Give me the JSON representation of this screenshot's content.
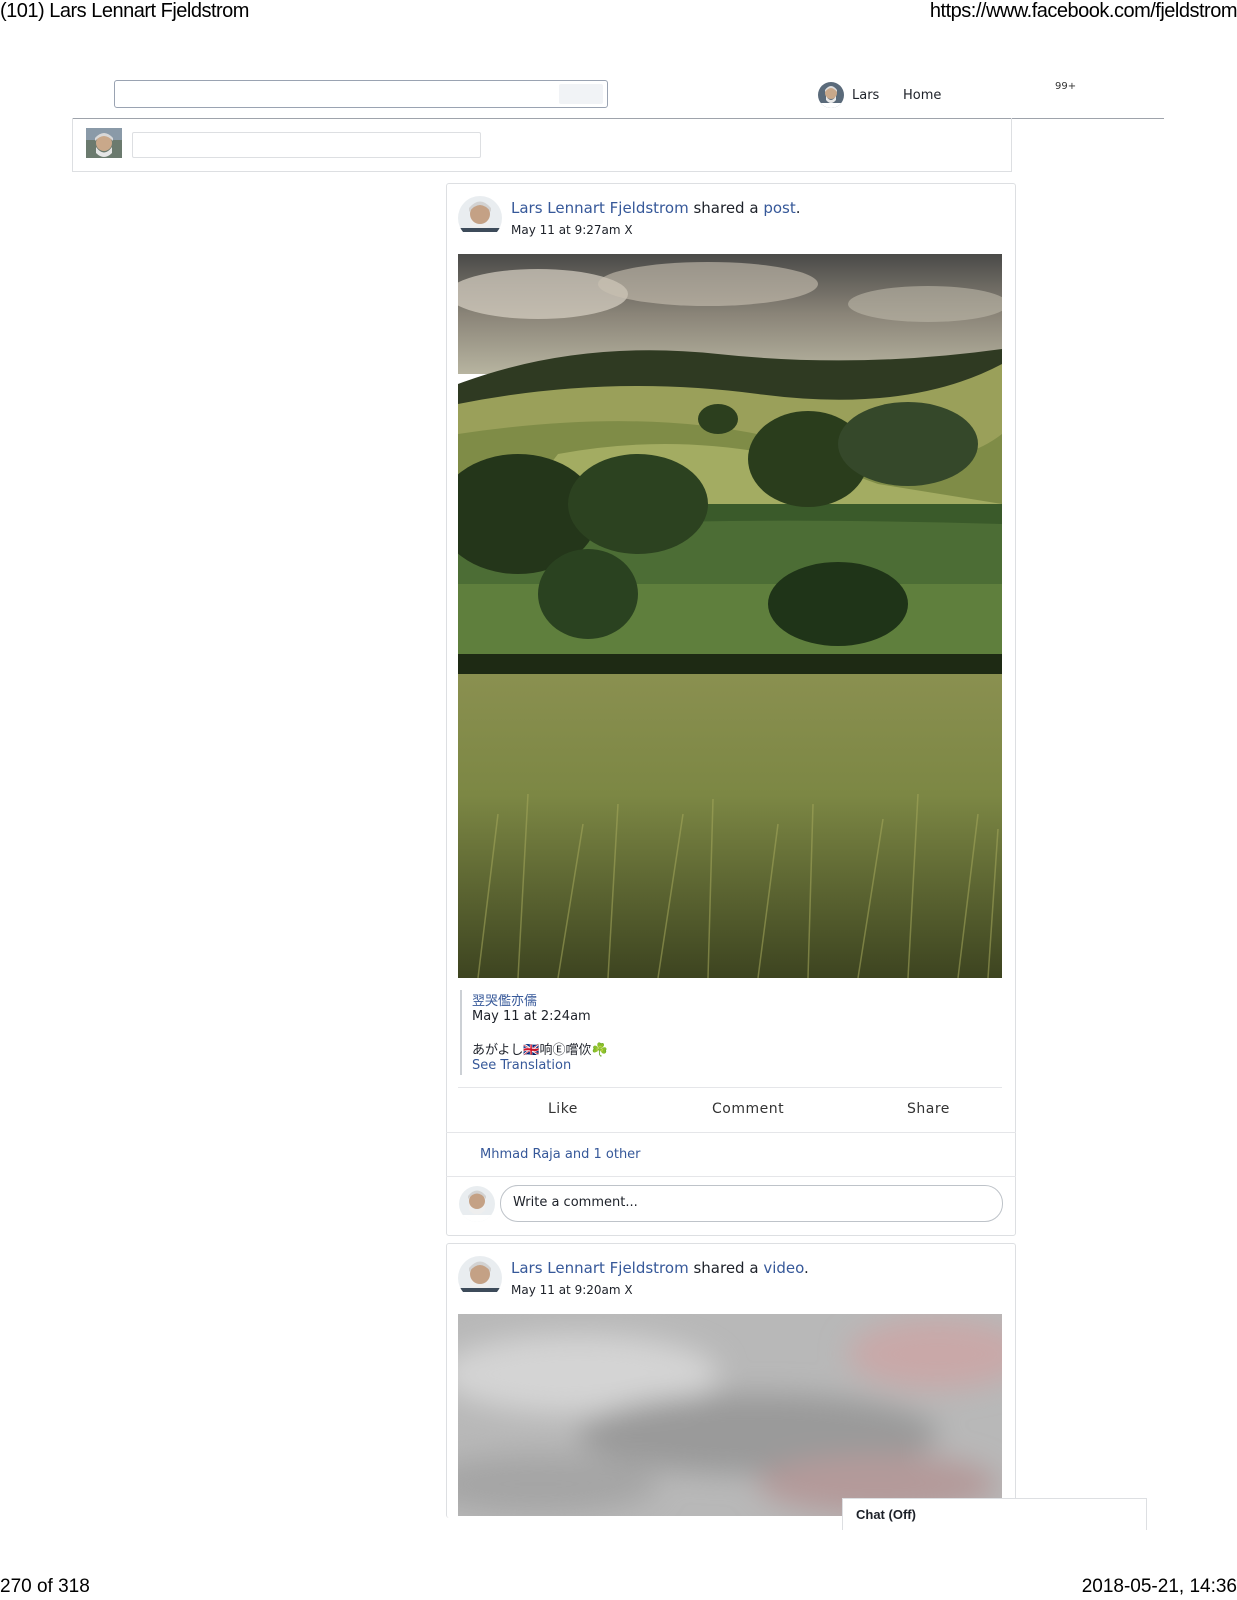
{
  "print": {
    "title": "(101) Lars Lennart Fjeldstrom",
    "url": "https://www.facebook.com/fjeldstrom",
    "page_counter": "270 of 318",
    "timestamp": "2018-05-21, 14:36"
  },
  "topbar": {
    "search_placeholder": "",
    "profile_name": "Lars",
    "home_label": "Home",
    "notifications_badge": "99+"
  },
  "posts": [
    {
      "author": "Lars Lennart Fjeldstrom",
      "action_text": "shared a",
      "object_link": "post",
      "period": ".",
      "time": "May 11 at 9:27am",
      "time_suffix": "X",
      "shared": {
        "author": "翌哭儖亦儒",
        "time": "May 11 at 2:24am",
        "text": "あがよし🇬🇧响Ⓔ嚐佽☘️",
        "translate_label": "See Translation"
      },
      "actions": [
        "Like",
        "Comment",
        "Share"
      ],
      "likes_text": "Mhmad Raja and 1 other",
      "comment_placeholder": "Write a comment..."
    },
    {
      "author": "Lars Lennart Fjeldstrom",
      "action_text": "shared a",
      "object_link": "video",
      "period": ".",
      "time": "May 11 at 9:20am",
      "time_suffix": "X"
    }
  ],
  "chat": {
    "label": "Chat (Off)"
  }
}
